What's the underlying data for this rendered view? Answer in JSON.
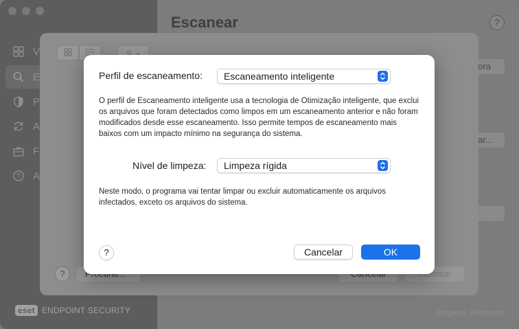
{
  "sidebar": {
    "items": [
      {
        "label": "V",
        "icon": "grid-icon"
      },
      {
        "label": "E",
        "icon": "search-icon"
      },
      {
        "label": "P",
        "icon": "shield-icon"
      },
      {
        "label": "A",
        "icon": "refresh-icon"
      },
      {
        "label": "F",
        "icon": "briefcase-icon"
      },
      {
        "label": "A",
        "icon": "help-circle-icon"
      }
    ],
    "brand_logo": "eset",
    "brand_text": "ENDPOINT SECURITY"
  },
  "main": {
    "title": "Escanear",
    "help_label": "?",
    "btn_now": "gora",
    "btn_more": "ear...",
    "btn_more2": "r...",
    "footer": "Progress. Protected."
  },
  "sheet": {
    "view_dropdown_label": "☺ ⌄",
    "help_label": "?",
    "scan_button": "Procurar...",
    "cancel_button": "Cancelar",
    "start_button": "Rastrear"
  },
  "dialog": {
    "profile_label": "Perfil de escaneamento:",
    "profile_value": "Escaneamento inteligente",
    "profile_description": "O perfil de Escaneamento inteligente usa a tecnologia de Otimização inteligente, que exclui os arquivos que foram detectados como limpos em um escaneamento anterior e não foram modificados desde esse escaneamento. Isso permite tempos de escaneamento mais baixos com um impacto mínimo na segurança do sistema.",
    "cleaning_label": "Nível de limpeza:",
    "cleaning_value": "Limpeza rígida",
    "cleaning_description": "Neste modo, o programa vai tentar limpar ou excluir automaticamente os arquivos infectados, exceto os arquivos do sistema.",
    "help_label": "?",
    "cancel_button": "Cancelar",
    "ok_button": "OK"
  },
  "colors": {
    "accent": "#1a73e8",
    "dialog_bg": "#ffffff"
  }
}
